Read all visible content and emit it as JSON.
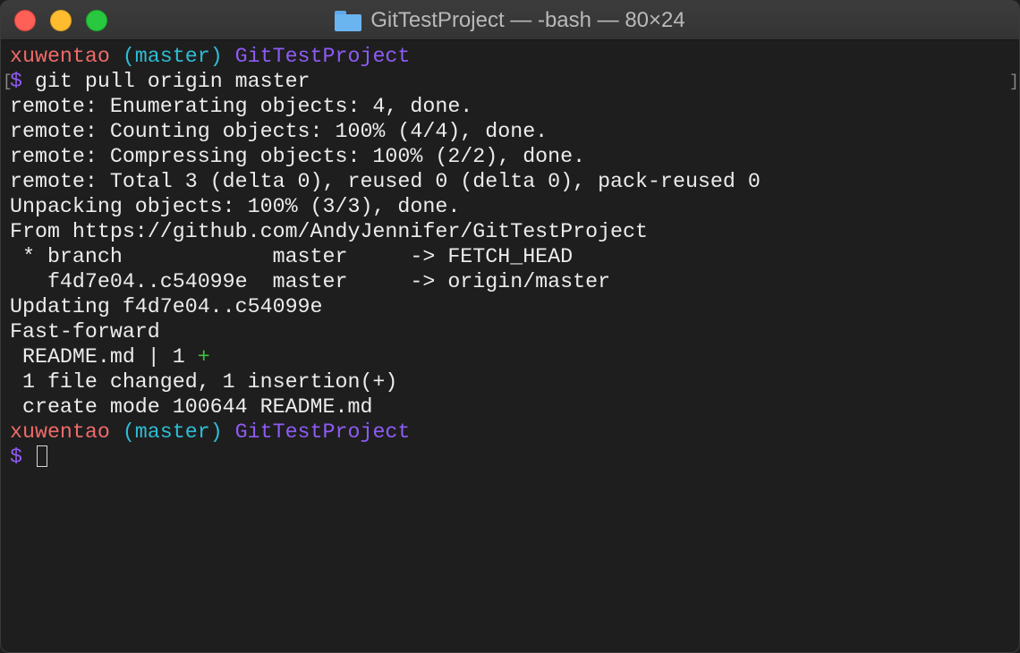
{
  "window": {
    "title": "GitTestProject — -bash — 80×24",
    "title_icon": "folder-icon"
  },
  "colors": {
    "background": "#1e1e1e",
    "text": "#ececec",
    "user": "#ef6a6a",
    "branch": "#2ebdd4",
    "directory": "#8e5bf5",
    "diffstat_plus": "#3cc43c"
  },
  "prompt": {
    "user": "xuwentao",
    "branch": "(master)",
    "directory": "GitTestProject",
    "symbol": "$"
  },
  "command": "git pull origin master",
  "output": [
    "remote: Enumerating objects: 4, done.",
    "remote: Counting objects: 100% (4/4), done.",
    "remote: Compressing objects: 100% (2/2), done.",
    "remote: Total 3 (delta 0), reused 0 (delta 0), pack-reused 0",
    "Unpacking objects: 100% (3/3), done.",
    "From https://github.com/AndyJennifer/GitTestProject",
    " * branch            master     -> FETCH_HEAD",
    "   f4d7e04..c54099e  master     -> origin/master",
    "Updating f4d7e04..c54099e",
    "Fast-forward"
  ],
  "diffstat": {
    "file_line": " README.md | 1 ",
    "plus": "+"
  },
  "summary": [
    " 1 file changed, 1 insertion(+)",
    " create mode 100644 README.md"
  ],
  "marks": {
    "left_bracket": "[",
    "right_bracket": "]"
  }
}
